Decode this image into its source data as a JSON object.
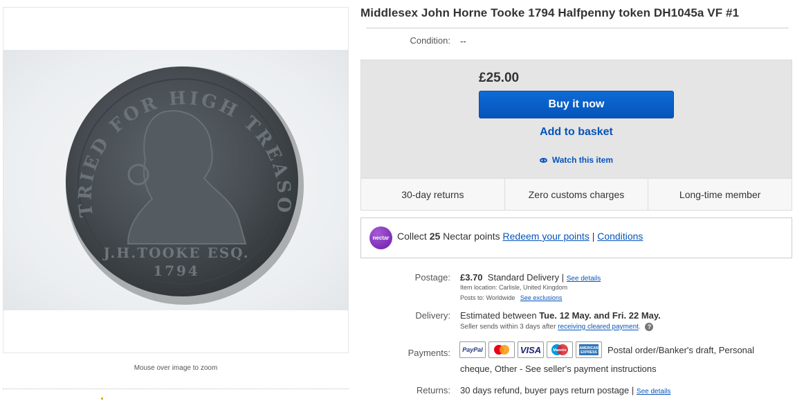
{
  "image_panel": {
    "zoom_hint": "Mouse over image to zoom"
  },
  "coin": {
    "legend": "TRIED FOR HIGH TREASON",
    "name": "J.H.TOOKE ESQ.",
    "year": "1794"
  },
  "title": "Middlesex John Horne Tooke 1794 Halfpenny token DH1045a VF #1",
  "condition": {
    "label": "Condition:",
    "value": "--"
  },
  "buybox": {
    "price": "£25.00",
    "buy_now": "Buy it now",
    "add_to_basket": "Add to basket",
    "watch": "Watch this item",
    "features": [
      "30-day returns",
      "Zero customs charges",
      "Long-time member"
    ]
  },
  "nectar": {
    "logo_text": "nectar",
    "prefix": "Collect",
    "points": "25",
    "middle": "Nectar points",
    "redeem": "Redeem your points",
    "separator": "|",
    "conditions": "Conditions"
  },
  "postage": {
    "label": "Postage:",
    "price": "£3.70",
    "service": "Standard Delivery",
    "separator": "|",
    "details_link": "See details",
    "location": "Item location:  Carlisle, United Kingdom",
    "posts_to": "Posts to:  Worldwide",
    "exclusions_link": "See exclusions"
  },
  "delivery": {
    "label": "Delivery:",
    "prefix": "Estimated between",
    "dates": "Tue. 12 May. and Fri. 22 May.",
    "note": "Seller sends within 3 days after",
    "note_link": "receiving cleared payment",
    "note_end": "."
  },
  "payments": {
    "label": "Payments:",
    "logos": [
      "PayPal",
      "Mastercard",
      "VISA",
      "Maestro",
      "American Express"
    ],
    "text_line1": "Postal order/Banker's draft, Personal",
    "text_line2": "cheque, Other - See seller's payment instructions"
  },
  "returns": {
    "label": "Returns:",
    "text": "30 days refund, buyer pays return postage",
    "separator": "|",
    "details_link": "See details"
  },
  "colors": {
    "ebay_blue": "#0654ba",
    "nectar_purple": "#7b2cbf",
    "buybox_bg": "#e5e5e5"
  }
}
